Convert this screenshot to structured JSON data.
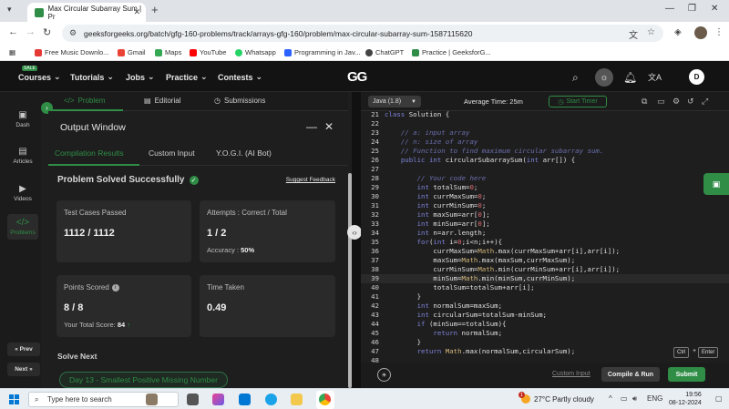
{
  "browser": {
    "tab_title": "Max Circular Subarray Sum | Pr",
    "url": "geeksforgeeks.org/batch/gfg-160-problems/track/arrays-gfg-160/problem/max-circular-subarray-sum-1587115620",
    "bookmarks": [
      "Free Music Downlo...",
      "Gmail",
      "Maps",
      "YouTube",
      "Whatsapp",
      "Programming in Jav...",
      "ChatGPT",
      "Practice | GeeksforG..."
    ]
  },
  "header": {
    "sale": "SALE",
    "menu": [
      "Courses",
      "Tutorials",
      "Jobs",
      "Practice",
      "Contests"
    ],
    "logo": "GG",
    "user_initial": "D"
  },
  "problem_tabs": [
    "Problem",
    "Editorial",
    "Submissions"
  ],
  "sidebar": {
    "items": [
      "Dash",
      "Articles",
      "Videos",
      "Problems"
    ],
    "prev": "« Prev",
    "next": "Next »"
  },
  "output": {
    "title": "Output Window",
    "tabs": [
      "Compilation Results",
      "Custom Input",
      "Y.O.G.I. (AI Bot)"
    ],
    "status": "Problem Solved Successfully",
    "suggest": "Suggest Feedback",
    "test_label": "Test Cases Passed",
    "test_value": "1112 / 1112",
    "attempts_label": "Attempts : Correct / Total",
    "attempts_value": "1 / 2",
    "accuracy_label": "Accuracy :",
    "accuracy_value": "50%",
    "points_label": "Points Scored",
    "points_value": "8 / 8",
    "total_score_label": "Your Total Score:",
    "total_score_value": "84",
    "time_label": "Time Taken",
    "time_value": "0.49",
    "solve_next": "Solve Next",
    "next_problem": "Day 13 - Smallest Positive Missing Number"
  },
  "editor": {
    "language": "Java (1.8)",
    "avg_time": "Average Time: 25m",
    "timer": "Start Timer",
    "lines": [
      {
        "n": "21",
        "t": "class Solution {"
      },
      {
        "n": "22",
        "t": ""
      },
      {
        "n": "23",
        "t": "    // a: input array"
      },
      {
        "n": "24",
        "t": "    // n: size of array"
      },
      {
        "n": "25",
        "t": "    // Function to find maximum circular subarray sum."
      },
      {
        "n": "26",
        "t": "    public int circularSubarraySum(int arr[]) {"
      },
      {
        "n": "27",
        "t": ""
      },
      {
        "n": "28",
        "t": "        // Your code here"
      },
      {
        "n": "29",
        "t": "        int totalSum=0;"
      },
      {
        "n": "30",
        "t": "        int currMaxSum=0;"
      },
      {
        "n": "31",
        "t": "        int currMinSum=0;"
      },
      {
        "n": "32",
        "t": "        int maxSum=arr[0];"
      },
      {
        "n": "33",
        "t": "        int minSum=arr[0];"
      },
      {
        "n": "34",
        "t": "        int n=arr.length;"
      },
      {
        "n": "35",
        "t": "        for(int i=0;i<n;i++){"
      },
      {
        "n": "36",
        "t": "            currMaxSum=Math.max(currMaxSum+arr[i],arr[i]);"
      },
      {
        "n": "37",
        "t": "            maxSum=Math.max(maxSum,currMaxSum);"
      },
      {
        "n": "38",
        "t": "            currMinSum=Math.min(currMinSum+arr[i],arr[i]);"
      },
      {
        "n": "39",
        "t": "            minSum=Math.min(minSum,currMinSum);"
      },
      {
        "n": "40",
        "t": "            totalSum=totalSum+arr[i];"
      },
      {
        "n": "41",
        "t": "        }"
      },
      {
        "n": "42",
        "t": "        int normalSum=maxSum;"
      },
      {
        "n": "43",
        "t": "        int circularSum=totalSum-minSum;"
      },
      {
        "n": "44",
        "t": "        if (minSum==totalSum){"
      },
      {
        "n": "45",
        "t": "            return normalSum;"
      },
      {
        "n": "46",
        "t": "        }"
      },
      {
        "n": "47",
        "t": "        return Math.max(normalSum,circularSum);"
      },
      {
        "n": "48",
        "t": ""
      }
    ],
    "highlight_line": "39",
    "shortcut": [
      "Ctrl",
      "+",
      "Enter"
    ],
    "custom_input": "Custom Input",
    "compile": "Compile & Run",
    "submit": "Submit"
  },
  "taskbar": {
    "search_placeholder": "Type here to search",
    "weather": "27°C  Partly cloudy",
    "badge": "1",
    "lang": "ENG",
    "time": "19:56",
    "date": "08-12-2024"
  },
  "colors": {
    "accent": "#2f8d46",
    "bg": "#1e1e1e",
    "card": "#2a2a2a"
  }
}
